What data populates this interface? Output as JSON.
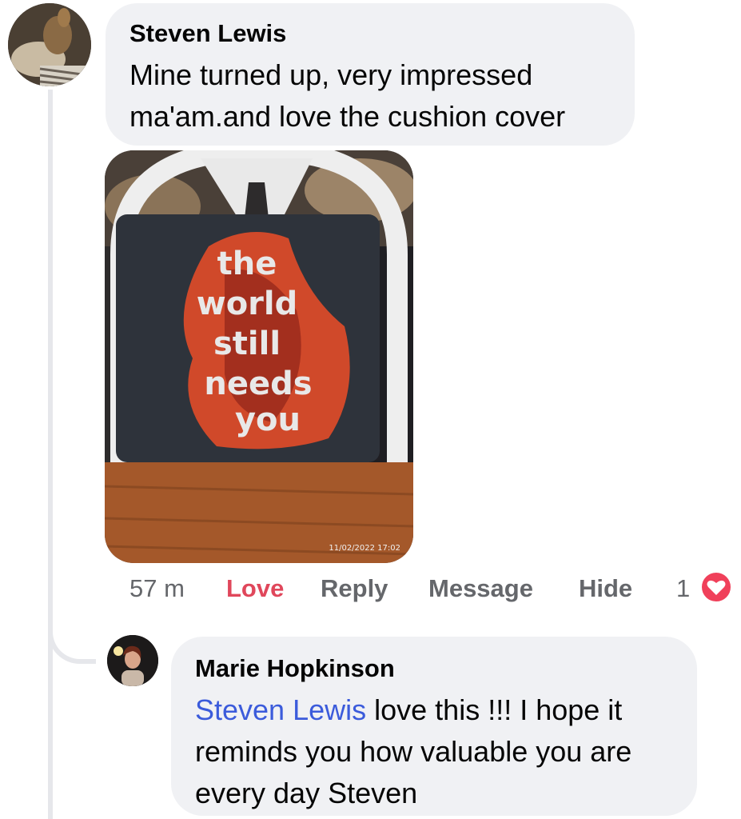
{
  "comment": {
    "author": "Steven Lewis",
    "text_line1": "Mine turned up, very impressed",
    "text_line2": "ma'am.and love the cushion cover",
    "photo": {
      "cushion_lines": [
        "the",
        "world",
        "still",
        "needs",
        "you"
      ],
      "timestamp": "11/02/2022 17:02"
    },
    "actions": {
      "time": "57 m",
      "love": "Love",
      "reply": "Reply",
      "message": "Message",
      "hide": "Hide",
      "reaction_count": "1"
    }
  },
  "reply": {
    "author": "Marie Hopkinson",
    "mention": "Steven Lewis",
    "text_after_mention": " love this !!! I hope it",
    "text_line2": "reminds you how valuable you are",
    "text_line3": "every day Steven"
  },
  "colors": {
    "love_accent": "#e0475b",
    "mention": "#3b5bdb",
    "bubble_bg": "#f0f1f4"
  }
}
